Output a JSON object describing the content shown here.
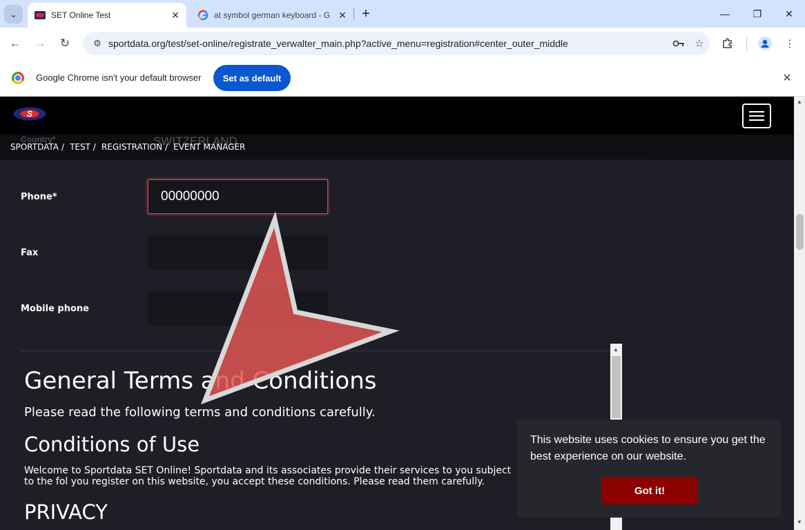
{
  "browser": {
    "tabs": [
      {
        "title": "SET Online Test",
        "active": true,
        "favicon": "sportdata-icon"
      },
      {
        "title": "at symbol german keyboard - G",
        "active": false,
        "favicon": "google-icon"
      }
    ],
    "url": "sportdata.org/test/set-online/registrate_verwalter_main.php?active_menu=registration#center_outer_middle",
    "infobar": {
      "message": "Google Chrome isn't your default browser",
      "button": "Set as default"
    },
    "accent_color": "#0b57d0"
  },
  "site": {
    "breadcrumb": [
      "SPORTDATA",
      "TEST",
      "REGISTRATION",
      "EVENT MANAGER"
    ],
    "ghost_label": "Country*",
    "ghost_value": "SWITZERLAND"
  },
  "form": {
    "phone_label": "Phone*",
    "phone_value": "00000000",
    "fax_label": "Fax",
    "fax_value": "",
    "mobile_label": "Mobile phone",
    "mobile_value": ""
  },
  "terms": {
    "title": "General Terms and Conditions",
    "subtitle": "Please read the following terms and conditions carefully.",
    "conditions_heading": "Conditions of Use",
    "conditions_text": "Welcome to Sportdata SET Online! Sportdata and its associates provide their services to you subject to the fol you register on this website, you accept these conditions. Please read them carefully.",
    "privacy_heading": "PRIVACY"
  },
  "cookie": {
    "text": "This website uses cookies to ensure you get the best experience on our website.",
    "button": "Got it!",
    "button_color": "#8b0000"
  }
}
